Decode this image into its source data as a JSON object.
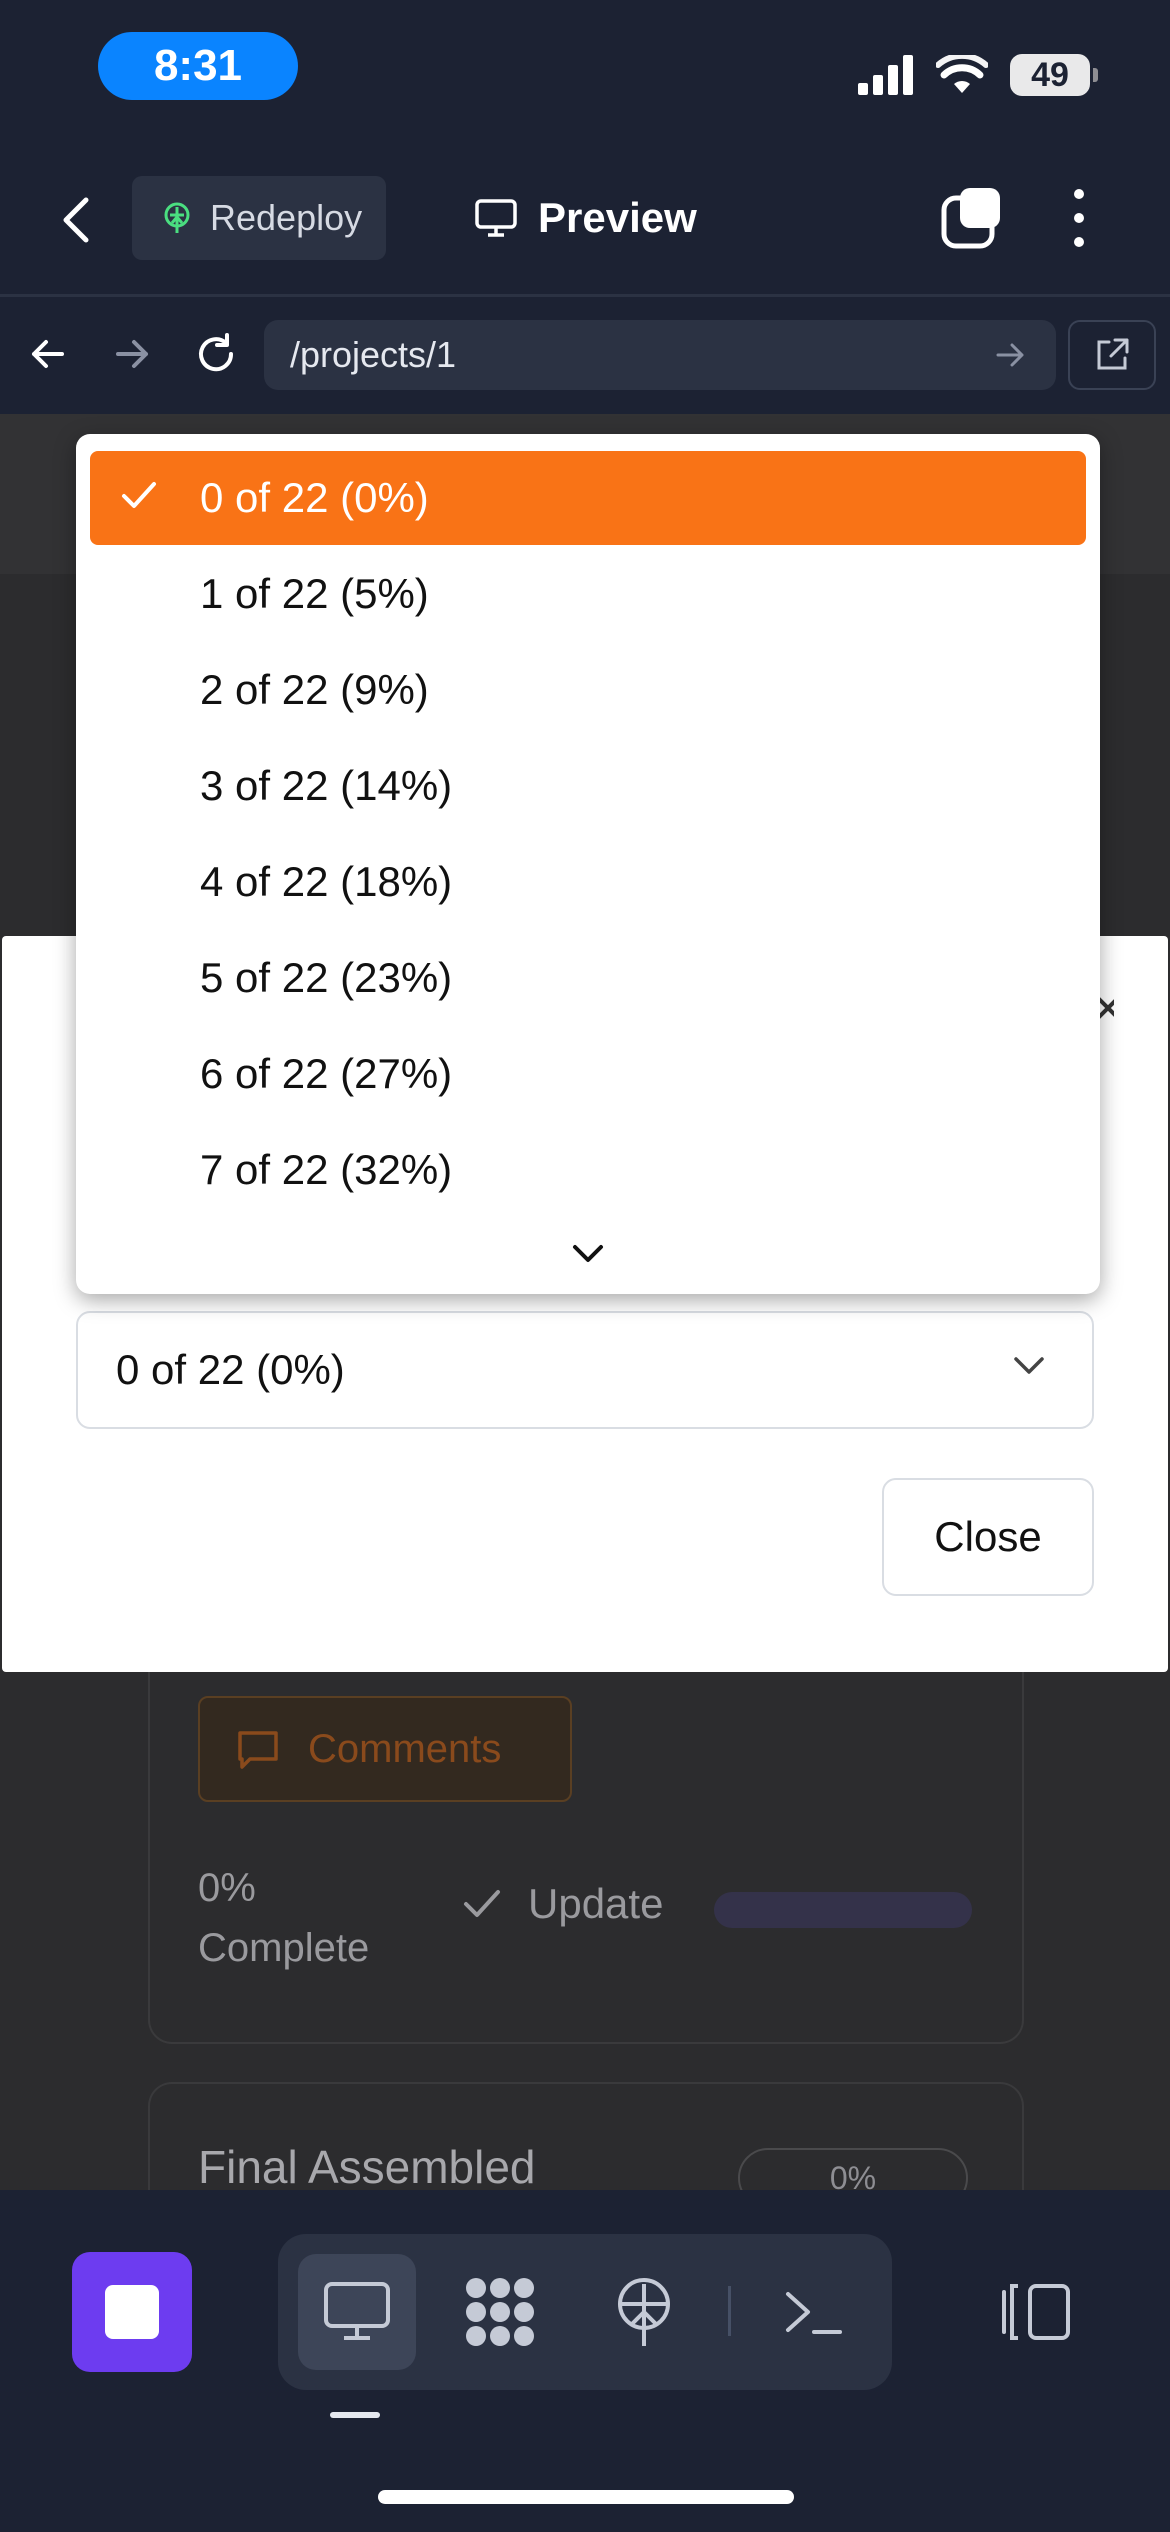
{
  "status_bar": {
    "time": "8:31",
    "battery": "49"
  },
  "header": {
    "redeploy_label": "Redeploy",
    "preview_label": "Preview"
  },
  "url_bar": {
    "path": "/projects/1"
  },
  "dropdown": {
    "options": [
      {
        "label": "0 of 22 (0%)",
        "selected": true
      },
      {
        "label": "1 of 22 (5%)"
      },
      {
        "label": "2 of 22 (9%)"
      },
      {
        "label": "3 of 22 (14%)"
      },
      {
        "label": "4 of 22 (18%)"
      },
      {
        "label": "5 of 22 (23%)"
      },
      {
        "label": "6 of 22 (27%)"
      },
      {
        "label": "7 of 22 (32%)"
      }
    ]
  },
  "modal": {
    "select_value": "0 of 22 (0%)",
    "close_label": "Close"
  },
  "card": {
    "comments_label": "Comments",
    "percent": "0%",
    "complete_label": "Complete",
    "update_label": "Update",
    "progress": 0
  },
  "next_card": {
    "title": "Final Assembled",
    "badge": "0%"
  },
  "colors": {
    "accent": "#f97316",
    "stop_button": "#6d3cf0",
    "time_pill": "#0a84ff"
  },
  "icons": {
    "toolbar": [
      "stop-icon",
      "desktop-icon",
      "apps-icon",
      "deploy-icon",
      "terminal-icon",
      "split-view-icon"
    ]
  }
}
